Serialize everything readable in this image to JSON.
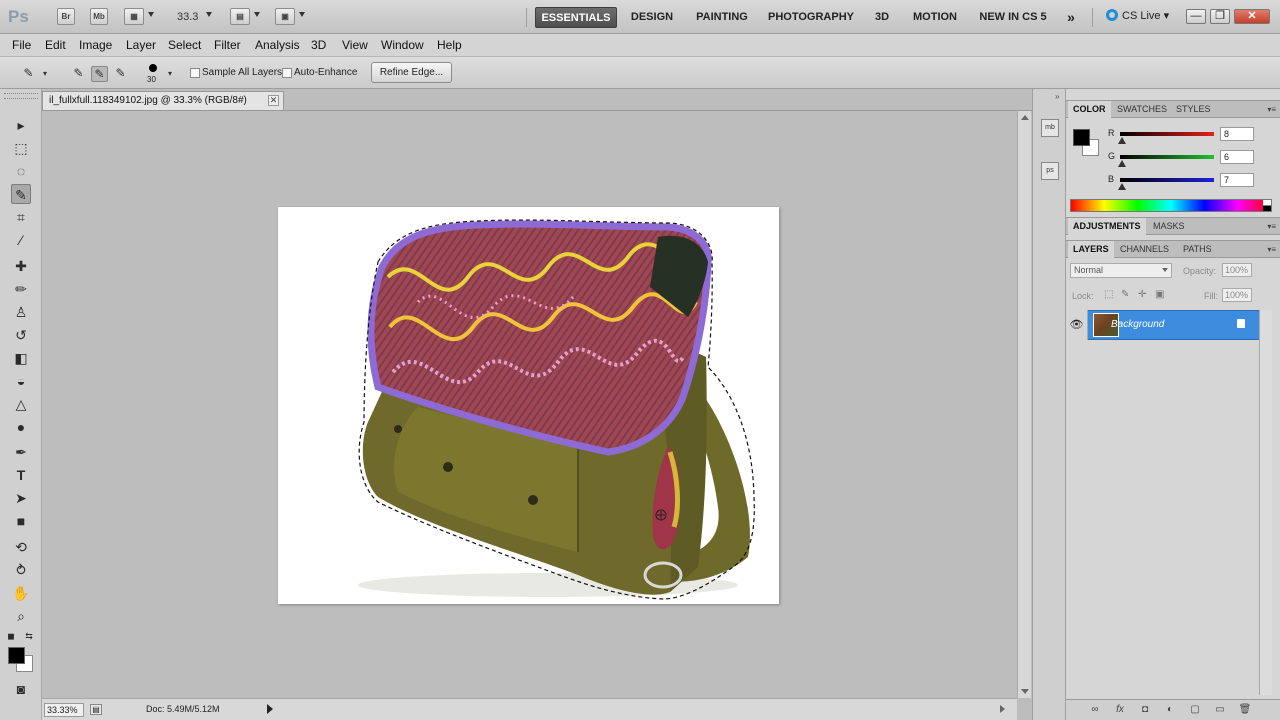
{
  "app": {
    "logo": "Ps",
    "bridge_label": "Br",
    "minibridge_label": "Mb",
    "zoom_level": "33.3",
    "workspaces": [
      "ESSENTIALS",
      "DESIGN",
      "PAINTING",
      "PHOTOGRAPHY",
      "3D",
      "MOTION",
      "NEW IN CS 5"
    ],
    "active_workspace": "ESSENTIALS",
    "more_workspaces": "»",
    "cs_live": "CS Live",
    "window_buttons": {
      "minimize": "—",
      "restore": "❐",
      "close": "✕"
    }
  },
  "menu": [
    "File",
    "Edit",
    "Image",
    "Layer",
    "Select",
    "Filter",
    "Analysis",
    "3D",
    "View",
    "Window",
    "Help"
  ],
  "options": {
    "brush_size": "30",
    "sample_all_layers": "Sample All Layers",
    "auto_enhance": "Auto-Enhance",
    "refine_edge": "Refine Edge..."
  },
  "document": {
    "tab_title": "il_fullxfull.118349102.jpg @ 33.3% (RGB/8#)",
    "close_glyph": "✕",
    "status_zoom": "33.33%",
    "status_doc": "Doc: 5.49M/5.12M"
  },
  "tools": [
    {
      "name": "move-tool",
      "glyph": "▸"
    },
    {
      "name": "marquee-tool",
      "glyph": "⬚"
    },
    {
      "name": "lasso-tool",
      "glyph": "◌"
    },
    {
      "name": "quick-selection-tool",
      "glyph": "✎"
    },
    {
      "name": "crop-tool",
      "glyph": "⌗"
    },
    {
      "name": "eyedropper-tool",
      "glyph": "⁄"
    },
    {
      "name": "healing-brush-tool",
      "glyph": "✚"
    },
    {
      "name": "brush-tool",
      "glyph": "✏"
    },
    {
      "name": "clone-stamp-tool",
      "glyph": "♙"
    },
    {
      "name": "history-brush-tool",
      "glyph": "↺"
    },
    {
      "name": "eraser-tool",
      "glyph": "◧"
    },
    {
      "name": "paint-bucket-tool",
      "glyph": "◒"
    },
    {
      "name": "blur-tool",
      "glyph": "△"
    },
    {
      "name": "dodge-tool",
      "glyph": "●"
    },
    {
      "name": "pen-tool",
      "glyph": "✒"
    },
    {
      "name": "type-tool",
      "glyph": "T"
    },
    {
      "name": "path-selection-tool",
      "glyph": "➤"
    },
    {
      "name": "shape-tool",
      "glyph": "■"
    },
    {
      "name": "3d-rotate-tool",
      "glyph": "⟲"
    },
    {
      "name": "3d-orbit-tool",
      "glyph": "⥁"
    },
    {
      "name": "hand-tool",
      "glyph": "✋"
    },
    {
      "name": "zoom-tool",
      "glyph": "⌕"
    }
  ],
  "color_panel": {
    "tabs": [
      "COLOR",
      "SWATCHES",
      "STYLES"
    ],
    "active_tab": "COLOR",
    "channels": [
      {
        "label": "R",
        "value": "8",
        "color": "#e8201c"
      },
      {
        "label": "G",
        "value": "6",
        "color": "#20c030"
      },
      {
        "label": "B",
        "value": "7",
        "color": "#2020d8"
      }
    ]
  },
  "adjust_panel": {
    "tabs": [
      "ADJUSTMENTS",
      "MASKS"
    ],
    "active_tab": "ADJUSTMENTS"
  },
  "layers_panel": {
    "tabs": [
      "LAYERS",
      "CHANNELS",
      "PATHS"
    ],
    "active_tab": "LAYERS",
    "blend_mode": "Normal",
    "opacity_label": "Opacity:",
    "opacity_value": "100%",
    "lock_label": "Lock:",
    "fill_label": "Fill:",
    "fill_value": "100%",
    "layer_name": "Background",
    "footer_icons": [
      "∞",
      "fx",
      "◘",
      "◐",
      "▢",
      "▭",
      "🗑"
    ]
  },
  "dock": [
    "mb",
    "ps"
  ],
  "panel_menu_glyph": "▾≡"
}
